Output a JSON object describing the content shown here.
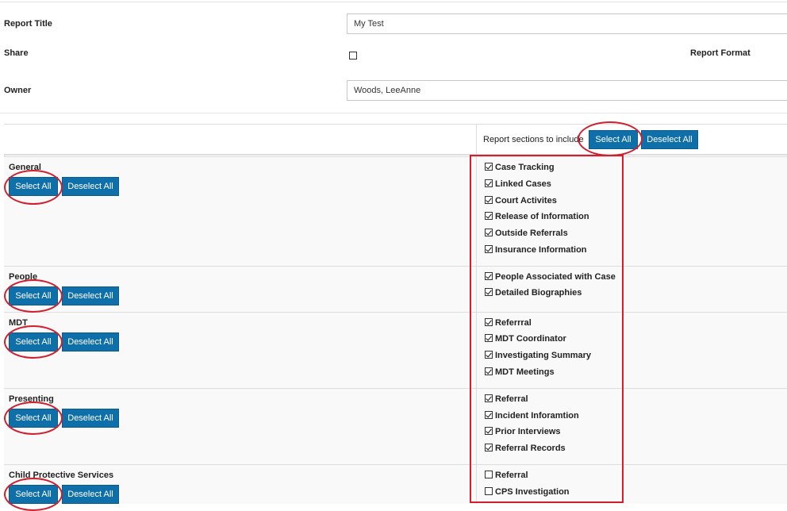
{
  "form": {
    "report_title_label": "Report Title",
    "report_title_value": "My Test",
    "share_label": "Share",
    "share_checked": false,
    "report_format_label": "Report Format",
    "owner_label": "Owner",
    "owner_value": "Woods, LeeAnne"
  },
  "header": {
    "sections_label": "Report sections to include",
    "select_all": "Select All",
    "deselect_all": "Deselect All"
  },
  "sections": [
    {
      "title": "General",
      "select_all": "Select All",
      "deselect_all": "Deselect All",
      "items": [
        {
          "label": "Case Tracking",
          "checked": true
        },
        {
          "label": "Linked Cases",
          "checked": true
        },
        {
          "label": "Court Activites",
          "checked": true
        },
        {
          "label": "Release of Information",
          "checked": true
        },
        {
          "label": "Outside Referrals",
          "checked": true
        },
        {
          "label": "Insurance Information",
          "checked": true
        }
      ]
    },
    {
      "title": "People",
      "select_all": "Select All",
      "deselect_all": "Deselect All",
      "items": [
        {
          "label": "People Associated with Case",
          "checked": true
        },
        {
          "label": "Detailed Biographies",
          "checked": true
        }
      ]
    },
    {
      "title": "MDT",
      "select_all": "Select All",
      "deselect_all": "Deselect All",
      "items": [
        {
          "label": "Referrral",
          "checked": true
        },
        {
          "label": "MDT Coordinator",
          "checked": true
        },
        {
          "label": "Investigating Summary",
          "checked": true
        },
        {
          "label": "MDT Meetings",
          "checked": true
        }
      ]
    },
    {
      "title": "Presenting",
      "select_all": "Select All",
      "deselect_all": "Deselect All",
      "items": [
        {
          "label": "Referral",
          "checked": true
        },
        {
          "label": "Incident Inforamtion",
          "checked": true
        },
        {
          "label": "Prior Interviews",
          "checked": true
        },
        {
          "label": "Referral Records",
          "checked": true
        }
      ]
    },
    {
      "title": "Child Protective Services",
      "select_all": "Select All",
      "deselect_all": "Deselect All",
      "items": [
        {
          "label": "Referral",
          "checked": false
        },
        {
          "label": "CPS Investigation",
          "checked": false
        }
      ]
    }
  ],
  "colors": {
    "button_bg": "#0f6fa8",
    "annotation_red": "#d0202f"
  }
}
